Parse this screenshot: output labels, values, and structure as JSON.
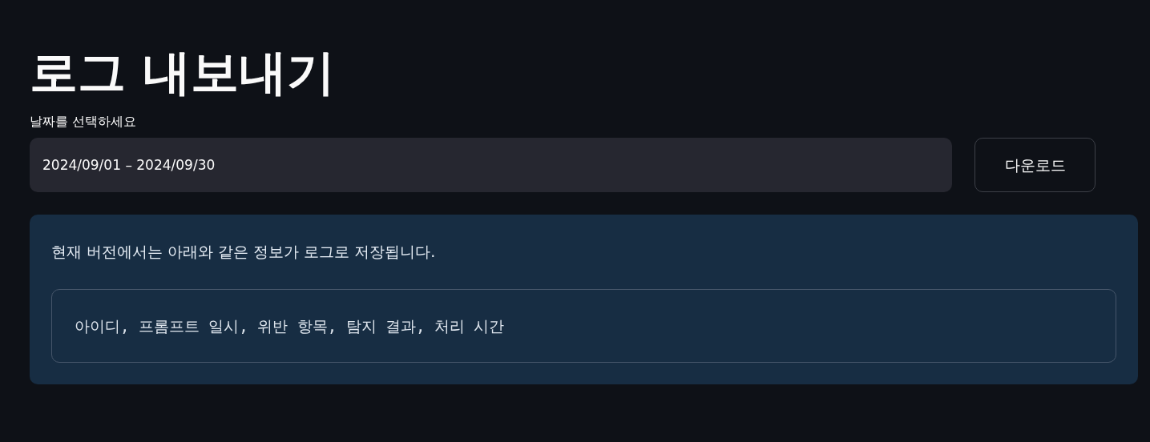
{
  "title": "로그 내보내기",
  "date_picker": {
    "label": "날짜를 선택하세요",
    "value": "2024/09/01 – 2024/09/30"
  },
  "download_button": {
    "label": "다운로드"
  },
  "info": {
    "message": "현재 버전에서는 아래와 같은 정보가 로그로 저장됩니다.",
    "code_block": "아이디, 프롬프트 일시, 위반 항목, 탐지 결과, 처리 시간"
  }
}
